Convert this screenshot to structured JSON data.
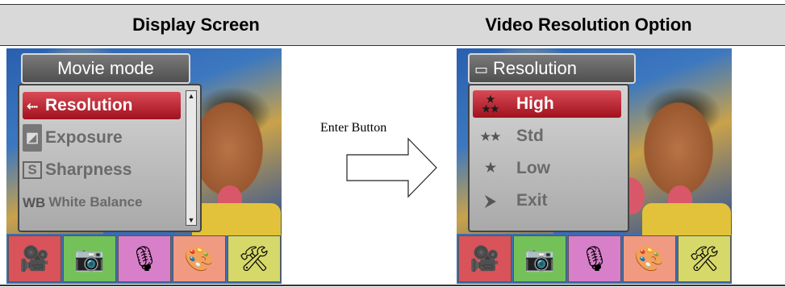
{
  "headers": {
    "left": "Display Screen",
    "right": "Video Resolution Option"
  },
  "arrow": {
    "label": "Enter Button",
    "icon": "right-arrow-icon"
  },
  "left_screen": {
    "title": "Movie mode",
    "items": [
      {
        "icon": "resolution-icon",
        "label": "Resolution",
        "selected": true
      },
      {
        "icon": "exposure-icon",
        "label": "Exposure",
        "selected": false
      },
      {
        "icon": "sharpness-icon",
        "label": "Sharpness",
        "selected": false
      },
      {
        "icon": "white-balance-icon",
        "icon_text": "WB",
        "label": "White Balance",
        "selected": false
      }
    ]
  },
  "right_screen": {
    "title": "Resolution",
    "items": [
      {
        "icon": "three-stars-icon",
        "label": "High",
        "selected": true
      },
      {
        "icon": "two-stars-icon",
        "label": "Std",
        "selected": false
      },
      {
        "icon": "one-star-icon",
        "label": "Low",
        "selected": false
      },
      {
        "icon": "exit-icon",
        "label": "Exit",
        "selected": false
      }
    ]
  },
  "tabs": [
    {
      "icon": "movie-camera-icon",
      "color": "#d9535b"
    },
    {
      "icon": "camera-icon",
      "color": "#74c15a"
    },
    {
      "icon": "microphone-icon",
      "color": "#d77fc9"
    },
    {
      "icon": "palette-icon",
      "color": "#f09a82"
    },
    {
      "icon": "tools-icon",
      "color": "#d6d86a"
    }
  ],
  "colors": {
    "selected_item": "#b5202c",
    "header_bg": "#d9d9d9"
  }
}
